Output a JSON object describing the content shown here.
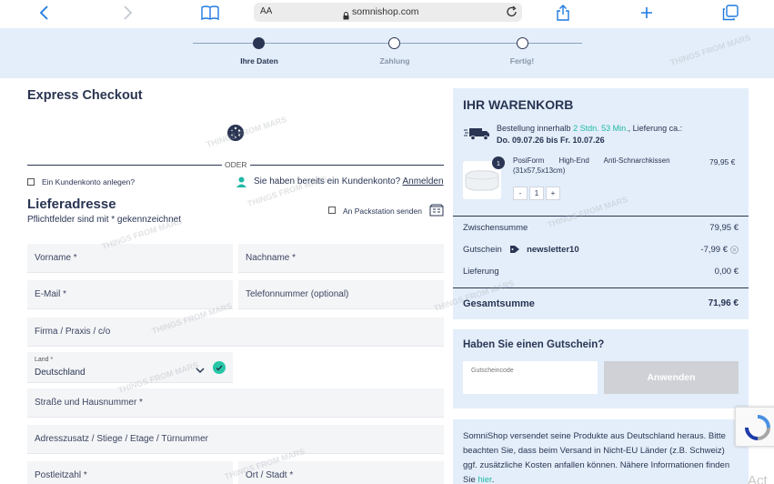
{
  "browser": {
    "text_size_label": "AA",
    "url": "somnishop.com"
  },
  "steps": [
    {
      "label": "Ihre Daten",
      "state": "active"
    },
    {
      "label": "Zahlung",
      "state": "pending"
    },
    {
      "label": "Fertig!",
      "state": "pending"
    }
  ],
  "checkout": {
    "express_title": "Express Checkout",
    "separator": "ODER",
    "create_account_label": "Ein Kundenkonto anlegen?",
    "existing_account_text": "Sie haben bereits ein Kundenkonto?",
    "login_link": "Anmelden",
    "delivery_title": "Lieferadresse",
    "required_note": "Pflichtfelder sind mit * gekennzeichnet",
    "packstation_label": "An Packstation senden",
    "fields": {
      "vorname": "Vorname *",
      "nachname": "Nachname *",
      "email": "E-Mail *",
      "telefon": "Telefonnummer (optional)",
      "firma": "Firma / Praxis / c/o",
      "land_label": "Land *",
      "land_value": "Deutschland",
      "strasse": "Straße und Hausnummer *",
      "adresszusatz": "Adresszusatz / Stiege / Etage / Türnummer",
      "plz": "Postleitzahl *",
      "ort": "Ort / Stadt *"
    }
  },
  "cart": {
    "title": "IHR WARENKORB",
    "shipping_prefix": "Bestellung innerhalb",
    "shipping_time": "2 Stdn. 53 Min.",
    "shipping_suffix": ", Lieferung ca.:",
    "delivery_dates": "Do. 09.07.26 bis Fr. 10.07.26",
    "item": {
      "quantity_badge": "1",
      "name_parts": [
        "PosiForm",
        "High-End",
        "Anti-Schnarchkissen"
      ],
      "size": "(31x57,5x13cm)",
      "price": "79,95 €",
      "minus": "-",
      "quantity": "1",
      "plus": "+"
    },
    "subtotal_label": "Zwischensumme",
    "subtotal_value": "79,95 €",
    "voucher_label": "Gutschein",
    "voucher_code": "newsletter10",
    "voucher_value": "-7,99 €",
    "delivery_label": "Lieferung",
    "delivery_value": "0,00 €",
    "total_label": "Gesamtsumme",
    "total_value": "71,96 €"
  },
  "coupon": {
    "title": "Haben Sie einen Gutschein?",
    "input_label": "Gutscheincode",
    "button": "Anwenden"
  },
  "info": {
    "text": "SomniShop versendet seine Produkte aus Deutschland heraus. Bitte beachten Sie, dass beim Versand in Nicht-EU Länder (z.B. Schweiz) ggf. zusätzliche Kosten anfallen können. Nähere Informationen finden Sie",
    "link": "hier",
    "suffix": "."
  },
  "overlay": {
    "watermark": "THINGS FROM MARS",
    "activate_text": "Act"
  },
  "colors": {
    "navy": "#2a3553",
    "panel": "#e3eefa",
    "teal": "#1fb8a5",
    "safari_blue": "#1f7ae0"
  }
}
